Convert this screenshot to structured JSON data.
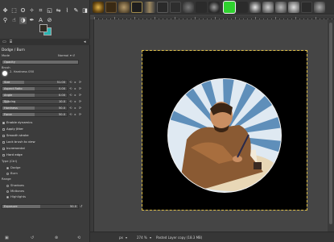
{
  "options": {
    "title": "Dodge / Burn",
    "mode_label": "Mode",
    "mode_value": "Normal",
    "opacity_label": "Opacity",
    "brush_label": "Brush",
    "brush_name": "2. Hardness 050",
    "size": {
      "label": "Size",
      "value": "51.00"
    },
    "aspect": {
      "label": "Aspect Ratio",
      "value": "0.00"
    },
    "angle": {
      "label": "Angle",
      "value": "0.00"
    },
    "spacing": {
      "label": "Spacing",
      "value": "10.0"
    },
    "hardness": {
      "label": "Hardness",
      "value": "50.0"
    },
    "force": {
      "label": "Force",
      "value": "50.0"
    },
    "checks": [
      {
        "label": "Enable dynamics",
        "on": true
      },
      {
        "label": "Apply Jitter",
        "on": false
      },
      {
        "label": "Smooth stroke",
        "on": false
      },
      {
        "label": "Lock brush to view",
        "on": false
      },
      {
        "label": "Incremental",
        "on": false
      },
      {
        "label": "Hard edge",
        "on": false
      }
    ],
    "type_label": "Type  (Ctrl)",
    "type_dodge": "Dodge",
    "type_burn": "Burn",
    "range_label": "Range",
    "range_shadows": "Shadows",
    "range_midtones": "Midtones",
    "range_highlights": "Highlights",
    "exposure": {
      "label": "Exposure",
      "value": "50.0"
    }
  },
  "status": {
    "unit": "px",
    "zoom": "274 %",
    "info": "Pasted Layer copy (18.3 MB)"
  },
  "colors": {
    "accent": "#e2c24a",
    "foreground": "#2f2a22",
    "background": "#2bb3b1"
  },
  "toolbar_icons": [
    "move-icon",
    "rect-select-icon",
    "lasso-icon",
    "fuzzy-select-icon",
    "crop-icon",
    "transform-icon",
    "flip-icon",
    "warp-icon",
    "paint-icon",
    "eraser-icon",
    "clone-icon",
    "smudge-icon",
    "dodge-icon",
    "path-icon",
    "text-icon",
    "color-picker-icon"
  ]
}
